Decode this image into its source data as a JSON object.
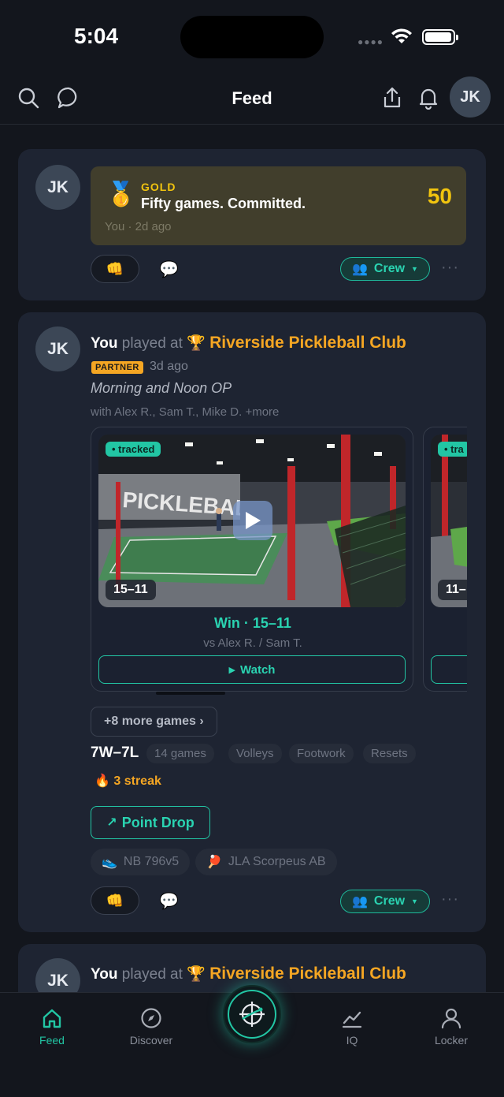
{
  "status": {
    "time": "5:04"
  },
  "header": {
    "title": "Feed",
    "avatar_initials": "JK"
  },
  "achievement_post": {
    "avatar_initials": "JK",
    "tier": "GOLD",
    "message": "Fifty games. Committed.",
    "meta": "You · 2d ago",
    "count": "50",
    "crew_label": "Crew",
    "more_label": "···"
  },
  "session_post": {
    "avatar_initials": "JK",
    "you": "You",
    "played_at": "played at",
    "club": "Riverside Pickleball Club",
    "badge": "PARTNER",
    "ago": "3d ago",
    "session_name": "Morning and Noon OP",
    "with": "with Alex R., Sam T., Mike D. +more",
    "game": {
      "tracked": "• tracked",
      "score_tag": "15–11",
      "result": "Win · 15–11",
      "opponents": "vs Alex R. / Sam T.",
      "watch": "Watch"
    },
    "next_game": {
      "tracked": "• tra",
      "score_tag": "11–"
    },
    "more_games": "+8 more games ›",
    "record": "7W–7L",
    "chips": [
      "14 games",
      "Volleys",
      "Footwork",
      "Resets"
    ],
    "streak": "3 streak",
    "point_drop": "Point Drop",
    "gear": [
      "NB 796v5",
      "JLA Scorpeus AB"
    ],
    "crew_label": "Crew",
    "more_label": "···"
  },
  "third_post": {
    "avatar_initials": "JK",
    "you": "You",
    "played_at": "played at",
    "club": "Riverside Pickleball Club"
  },
  "tabs": [
    {
      "label": "Feed",
      "icon": "home-icon",
      "active": true
    },
    {
      "label": "Discover",
      "icon": "compass-icon",
      "active": false
    },
    {
      "label": "",
      "icon": "record-icon",
      "active": false
    },
    {
      "label": "IQ",
      "icon": "chart-icon",
      "active": false
    },
    {
      "label": "Locker",
      "icon": "person-icon",
      "active": false
    }
  ],
  "colors": {
    "accent": "#22c6a4",
    "gold": "#f1c40f",
    "orange": "#f5a623",
    "background": "#13161d",
    "card": "#1e2432"
  }
}
